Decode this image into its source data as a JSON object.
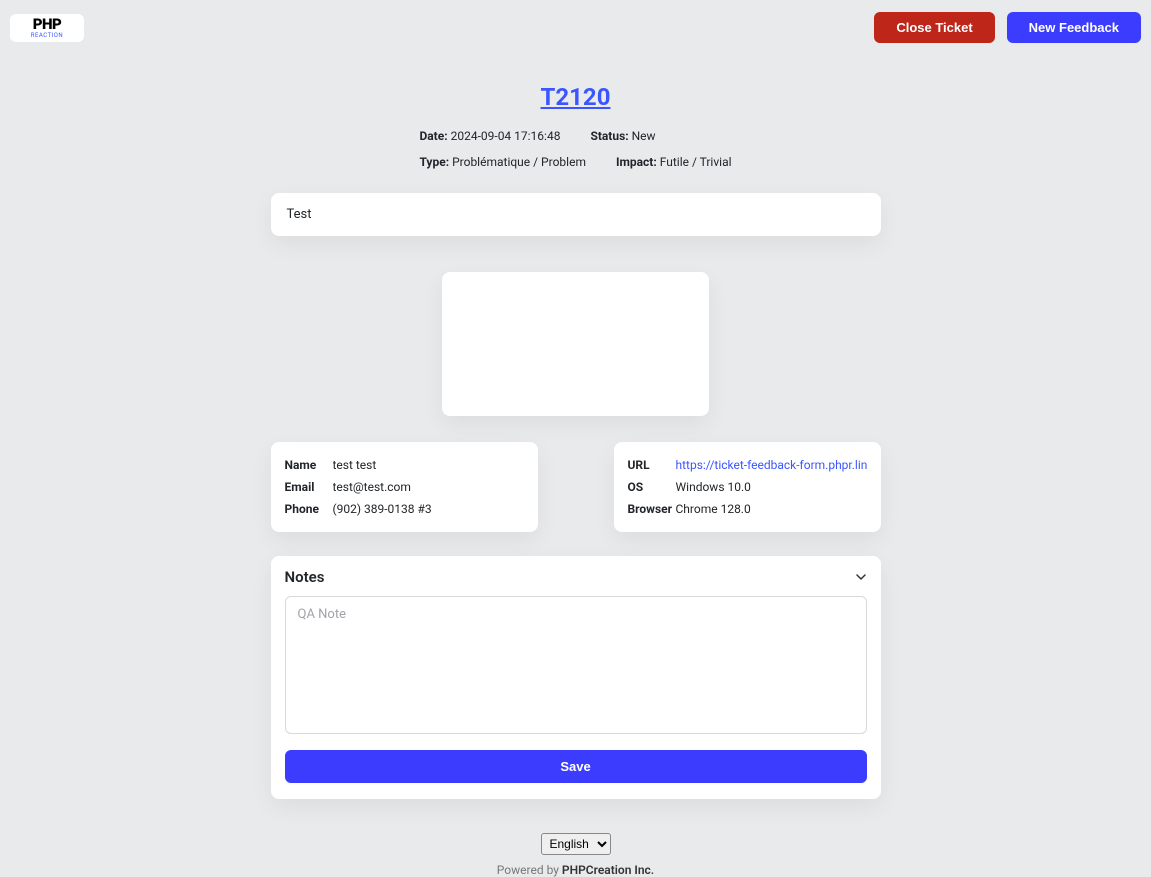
{
  "header": {
    "logo_main": "PHP",
    "logo_sub": "REACTION",
    "close_ticket": "Close Ticket",
    "new_feedback": "New Feedback"
  },
  "ticket": {
    "id": "T2120",
    "date_label": "Date:",
    "date_value": "2024-09-04 17:16:48",
    "status_label": "Status:",
    "status_value": "New",
    "type_label": "Type:",
    "type_value": "Problématique / Problem",
    "impact_label": "Impact:",
    "impact_value": "Futile / Trivial",
    "subject": "Test"
  },
  "contact": {
    "name_label": "Name",
    "name_value": "test test",
    "email_label": "Email",
    "email_value": "test@test.com",
    "phone_label": "Phone",
    "phone_value": "(902) 389-0138 #3"
  },
  "tech": {
    "url_label": "URL",
    "url_value": "https://ticket-feedback-form.phpr.link/en/fe",
    "os_label": "OS",
    "os_value": "Windows 10.0",
    "browser_label": "Browser",
    "browser_value": "Chrome 128.0"
  },
  "notes": {
    "title": "Notes",
    "placeholder": "QA Note",
    "save_label": "Save"
  },
  "footer": {
    "lang_selected": "English",
    "powered_by": "Powered by ",
    "company": "PHPCreation Inc."
  }
}
